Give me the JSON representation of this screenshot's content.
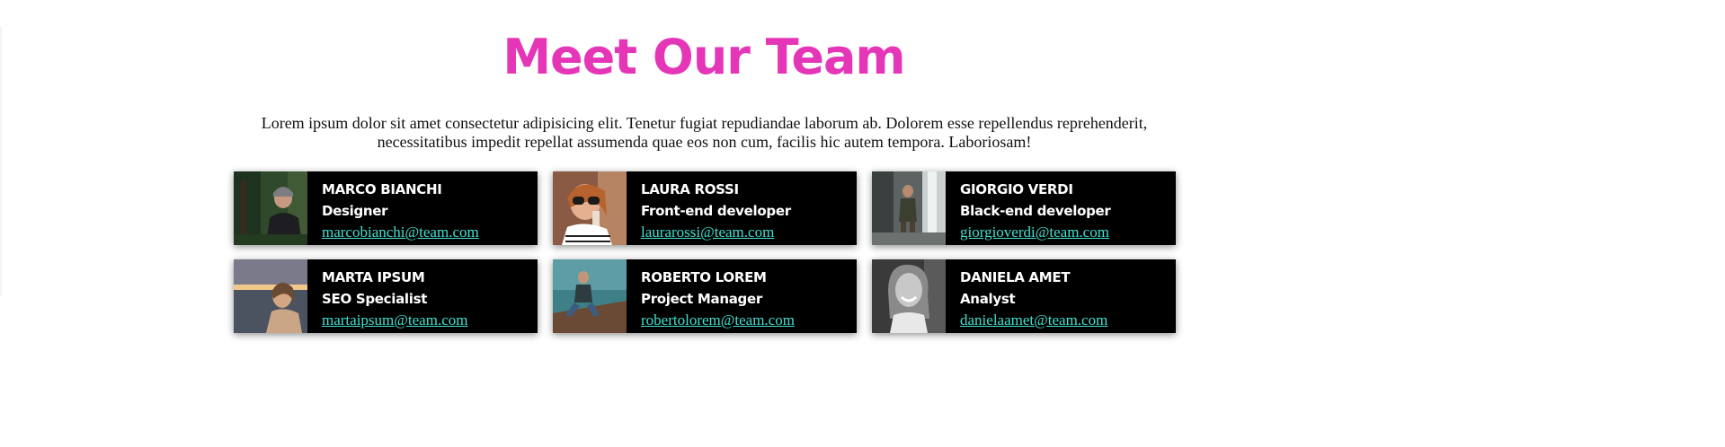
{
  "header": {
    "title": "Meet Our Team",
    "intro": "Lorem ipsum dolor sit amet consectetur adipisicing elit. Tenetur fugiat repudiandae laborum ab. Dolorem esse repellendus reprehenderit, necessitatibus impedit repellat assumenda quae eos non cum, facilis hic autem tempora. Laboriosam!"
  },
  "colors": {
    "title": "#e536b7",
    "card_bg": "#000000",
    "name_text": "#ffffff",
    "email_link": "#40e0d0"
  },
  "team": [
    {
      "name": "MARCO BIANCHI",
      "role": "Designer",
      "email": "marcobianchi@team.com",
      "photo": "portrait-man-beanie-forest"
    },
    {
      "name": "LAURA ROSSI",
      "role": "Front-end developer",
      "email": "laurarossi@team.com",
      "photo": "portrait-woman-sunglasses-drink"
    },
    {
      "name": "GIORGIO VERDI",
      "role": "Black-end developer",
      "email": "giorgioverdi@team.com",
      "photo": "portrait-man-waterfall"
    },
    {
      "name": "MARTA IPSUM",
      "role": "SEO Specialist",
      "email": "martaipsum@team.com",
      "photo": "portrait-woman-sunset-lake"
    },
    {
      "name": "ROBERTO LOREM",
      "role": "Project Manager",
      "email": "robertolorem@team.com",
      "photo": "portrait-man-sitting-outdoors"
    },
    {
      "name": "DANIELA AMET",
      "role": "Analyst",
      "email": "danielaamet@team.com",
      "photo": "portrait-woman-smiling-bw"
    }
  ]
}
